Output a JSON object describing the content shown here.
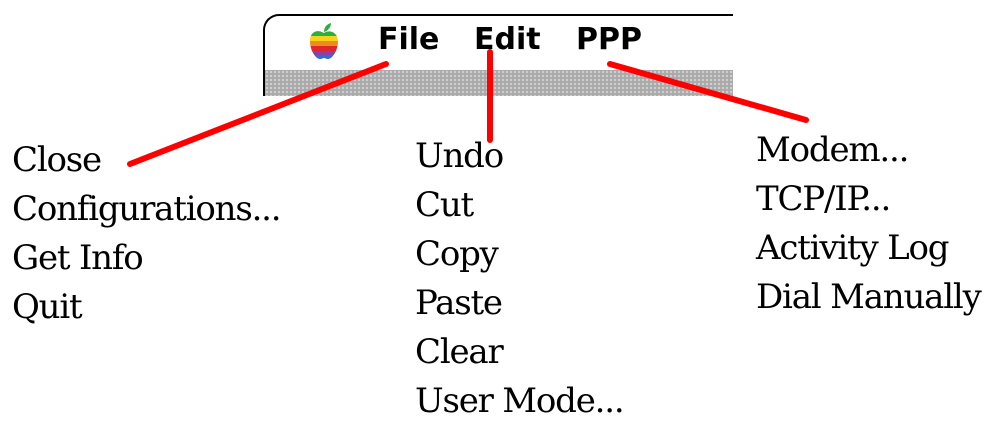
{
  "menubar": {
    "apple_menu_icon": "apple-rainbow-icon",
    "titles": [
      "File",
      "Edit",
      "PPP"
    ]
  },
  "menus": {
    "file": [
      "Close",
      "Configurations...",
      "Get Info",
      "Quit"
    ],
    "edit": [
      "Undo",
      "Cut",
      "Copy",
      "Paste",
      "Clear",
      "User Mode..."
    ],
    "ppp": [
      "Modem...",
      "TCP/IP...",
      "Activity Log",
      "Dial Manually"
    ]
  },
  "colors": {
    "callout_line": "#ff0000",
    "menubar_pattern": "#a9a9a9",
    "text": "#000000"
  }
}
